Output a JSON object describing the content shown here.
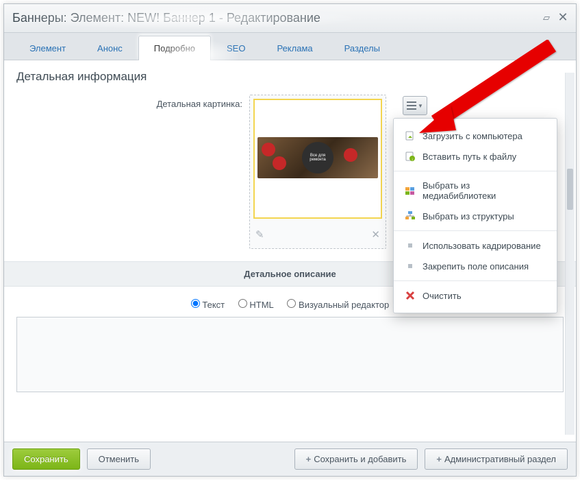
{
  "titlebar": {
    "title": "Баннеры: Элемент: NEW! Баннер 1 - Редактирование"
  },
  "tabs": {
    "element": "Элемент",
    "anons": "Анонс",
    "detail": "Подробно",
    "seo": "SEO",
    "ads": "Реклама",
    "sections": "Разделы"
  },
  "section": {
    "heading": "Детальная информация",
    "image_label": "Детальная картинка:"
  },
  "menu": {
    "upload": "Загрузить с компьютера",
    "path": "Вставить путь к файлу",
    "media": "Выбрать из медиабиблиотеки",
    "structure": "Выбрать из структуры",
    "crop": "Использовать кадрирование",
    "pin": "Закрепить поле описания",
    "clear": "Очистить"
  },
  "desc": {
    "header": "Детальное описание",
    "mode_text": "Текст",
    "mode_html": "HTML",
    "mode_visual": "Визуальный редактор"
  },
  "footer": {
    "save": "Сохранить",
    "cancel": "Отменить",
    "save_add": "Сохранить и добавить",
    "admin": "Административный раздел"
  },
  "thumb_caption": "Все для ремонта"
}
